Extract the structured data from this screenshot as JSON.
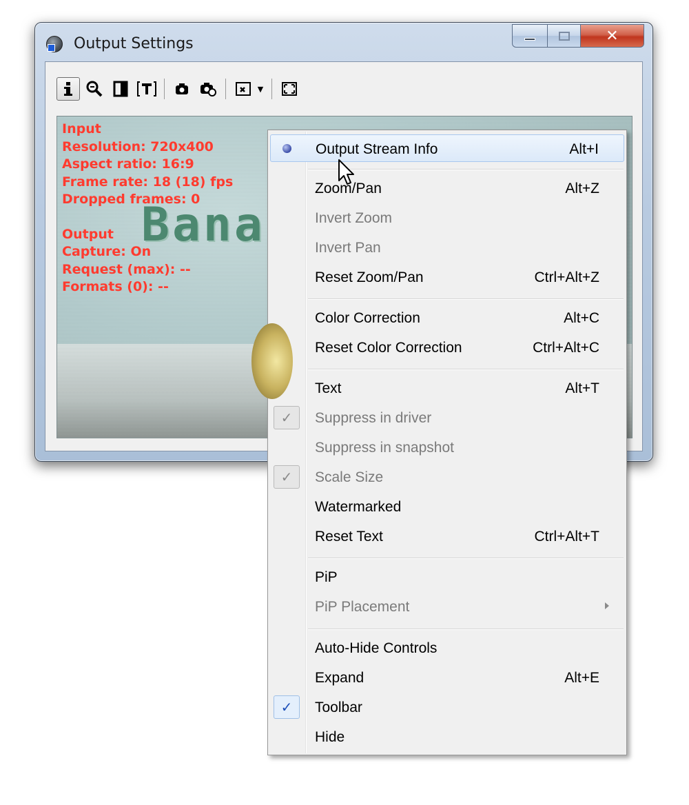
{
  "window": {
    "title": "Output Settings"
  },
  "toolbar": {
    "buttons": [
      {
        "name": "info-icon",
        "glyph": "i",
        "active": true
      },
      {
        "name": "zoom-icon",
        "glyph": "🔍"
      },
      {
        "name": "color-correction-icon",
        "glyph": "◧"
      },
      {
        "name": "text-icon",
        "glyph": "[T]"
      },
      {
        "name": "snapshot-icon",
        "glyph": "📷"
      },
      {
        "name": "snapshot-settings-icon",
        "glyph": "📷"
      },
      {
        "name": "pip-icon",
        "glyph": "⊠"
      },
      {
        "name": "expand-icon",
        "glyph": "⛶"
      }
    ]
  },
  "overlay": {
    "input_header": "Input",
    "resolution": "Resolution: 720x400",
    "aspect": "Aspect ratio: 16:9",
    "framerate": "Frame rate: 18 (18) fps",
    "dropped": "Dropped frames: 0",
    "output_header": "Output",
    "capture": "Capture: On",
    "request": "Request (max): --",
    "formats": "Formats (0): --"
  },
  "video": {
    "banner_text": "Bana"
  },
  "menu": {
    "items": [
      {
        "label": "Output Stream Info",
        "shortcut": "Alt+I"
      },
      {
        "label": "Zoom/Pan",
        "shortcut": "Alt+Z"
      },
      {
        "label": "Invert Zoom",
        "shortcut": ""
      },
      {
        "label": "Invert Pan",
        "shortcut": ""
      },
      {
        "label": "Reset Zoom/Pan",
        "shortcut": "Ctrl+Alt+Z"
      },
      {
        "label": "Color Correction",
        "shortcut": "Alt+C"
      },
      {
        "label": "Reset Color Correction",
        "shortcut": "Ctrl+Alt+C"
      },
      {
        "label": "Text",
        "shortcut": "Alt+T"
      },
      {
        "label": "Suppress in driver",
        "shortcut": ""
      },
      {
        "label": "Suppress in snapshot",
        "shortcut": ""
      },
      {
        "label": "Scale Size",
        "shortcut": ""
      },
      {
        "label": "Watermarked",
        "shortcut": ""
      },
      {
        "label": "Reset Text",
        "shortcut": "Ctrl+Alt+T"
      },
      {
        "label": "PiP",
        "shortcut": ""
      },
      {
        "label": "PiP Placement",
        "shortcut": ""
      },
      {
        "label": "Auto-Hide Controls",
        "shortcut": ""
      },
      {
        "label": "Expand",
        "shortcut": "Alt+E"
      },
      {
        "label": "Toolbar",
        "shortcut": ""
      },
      {
        "label": "Hide",
        "shortcut": ""
      }
    ],
    "check_glyph": "✓"
  },
  "colors": {
    "overlay_text": "#ff3b2f",
    "disabled_text": "#7a7a7a",
    "highlight": "#dce9f9"
  }
}
